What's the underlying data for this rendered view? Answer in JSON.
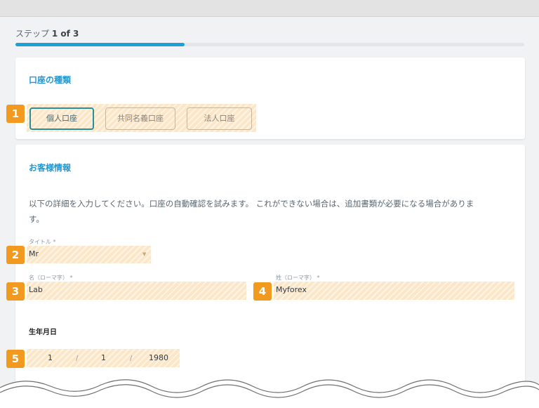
{
  "progress": {
    "step_prefix": "ステップ",
    "step_count": "1 of 3",
    "fraction": 0.333
  },
  "account_type": {
    "title": "口座の種類",
    "options": [
      "個人口座",
      "共同名義口座",
      "法人口座"
    ],
    "selected": "個人口座"
  },
  "customer_info": {
    "title": "お客様情報",
    "intro": "以下の詳細を入力してください。口座の自動確認を試みます。 これができない場合は、追加書類が必要になる場合がありま",
    "intro_continued": "す。",
    "title_field": {
      "label": "タイトル *",
      "value": "Mr"
    },
    "first_name": {
      "label": "名（ローマ字） *",
      "value": "Lab"
    },
    "last_name": {
      "label": "姓（ローマ字） *",
      "value": "Myforex"
    },
    "dob": {
      "label": "生年月日",
      "day": "1",
      "month": "1",
      "year": "1980",
      "separator": "/"
    }
  },
  "annotations": [
    "1",
    "2",
    "3",
    "4",
    "5"
  ],
  "colors": {
    "accent": "#2197d3",
    "progress": "#1ba0d8",
    "badge": "#f29a1f",
    "highlight": "#fbe6c8",
    "selected_border": "#2a8f9a"
  }
}
